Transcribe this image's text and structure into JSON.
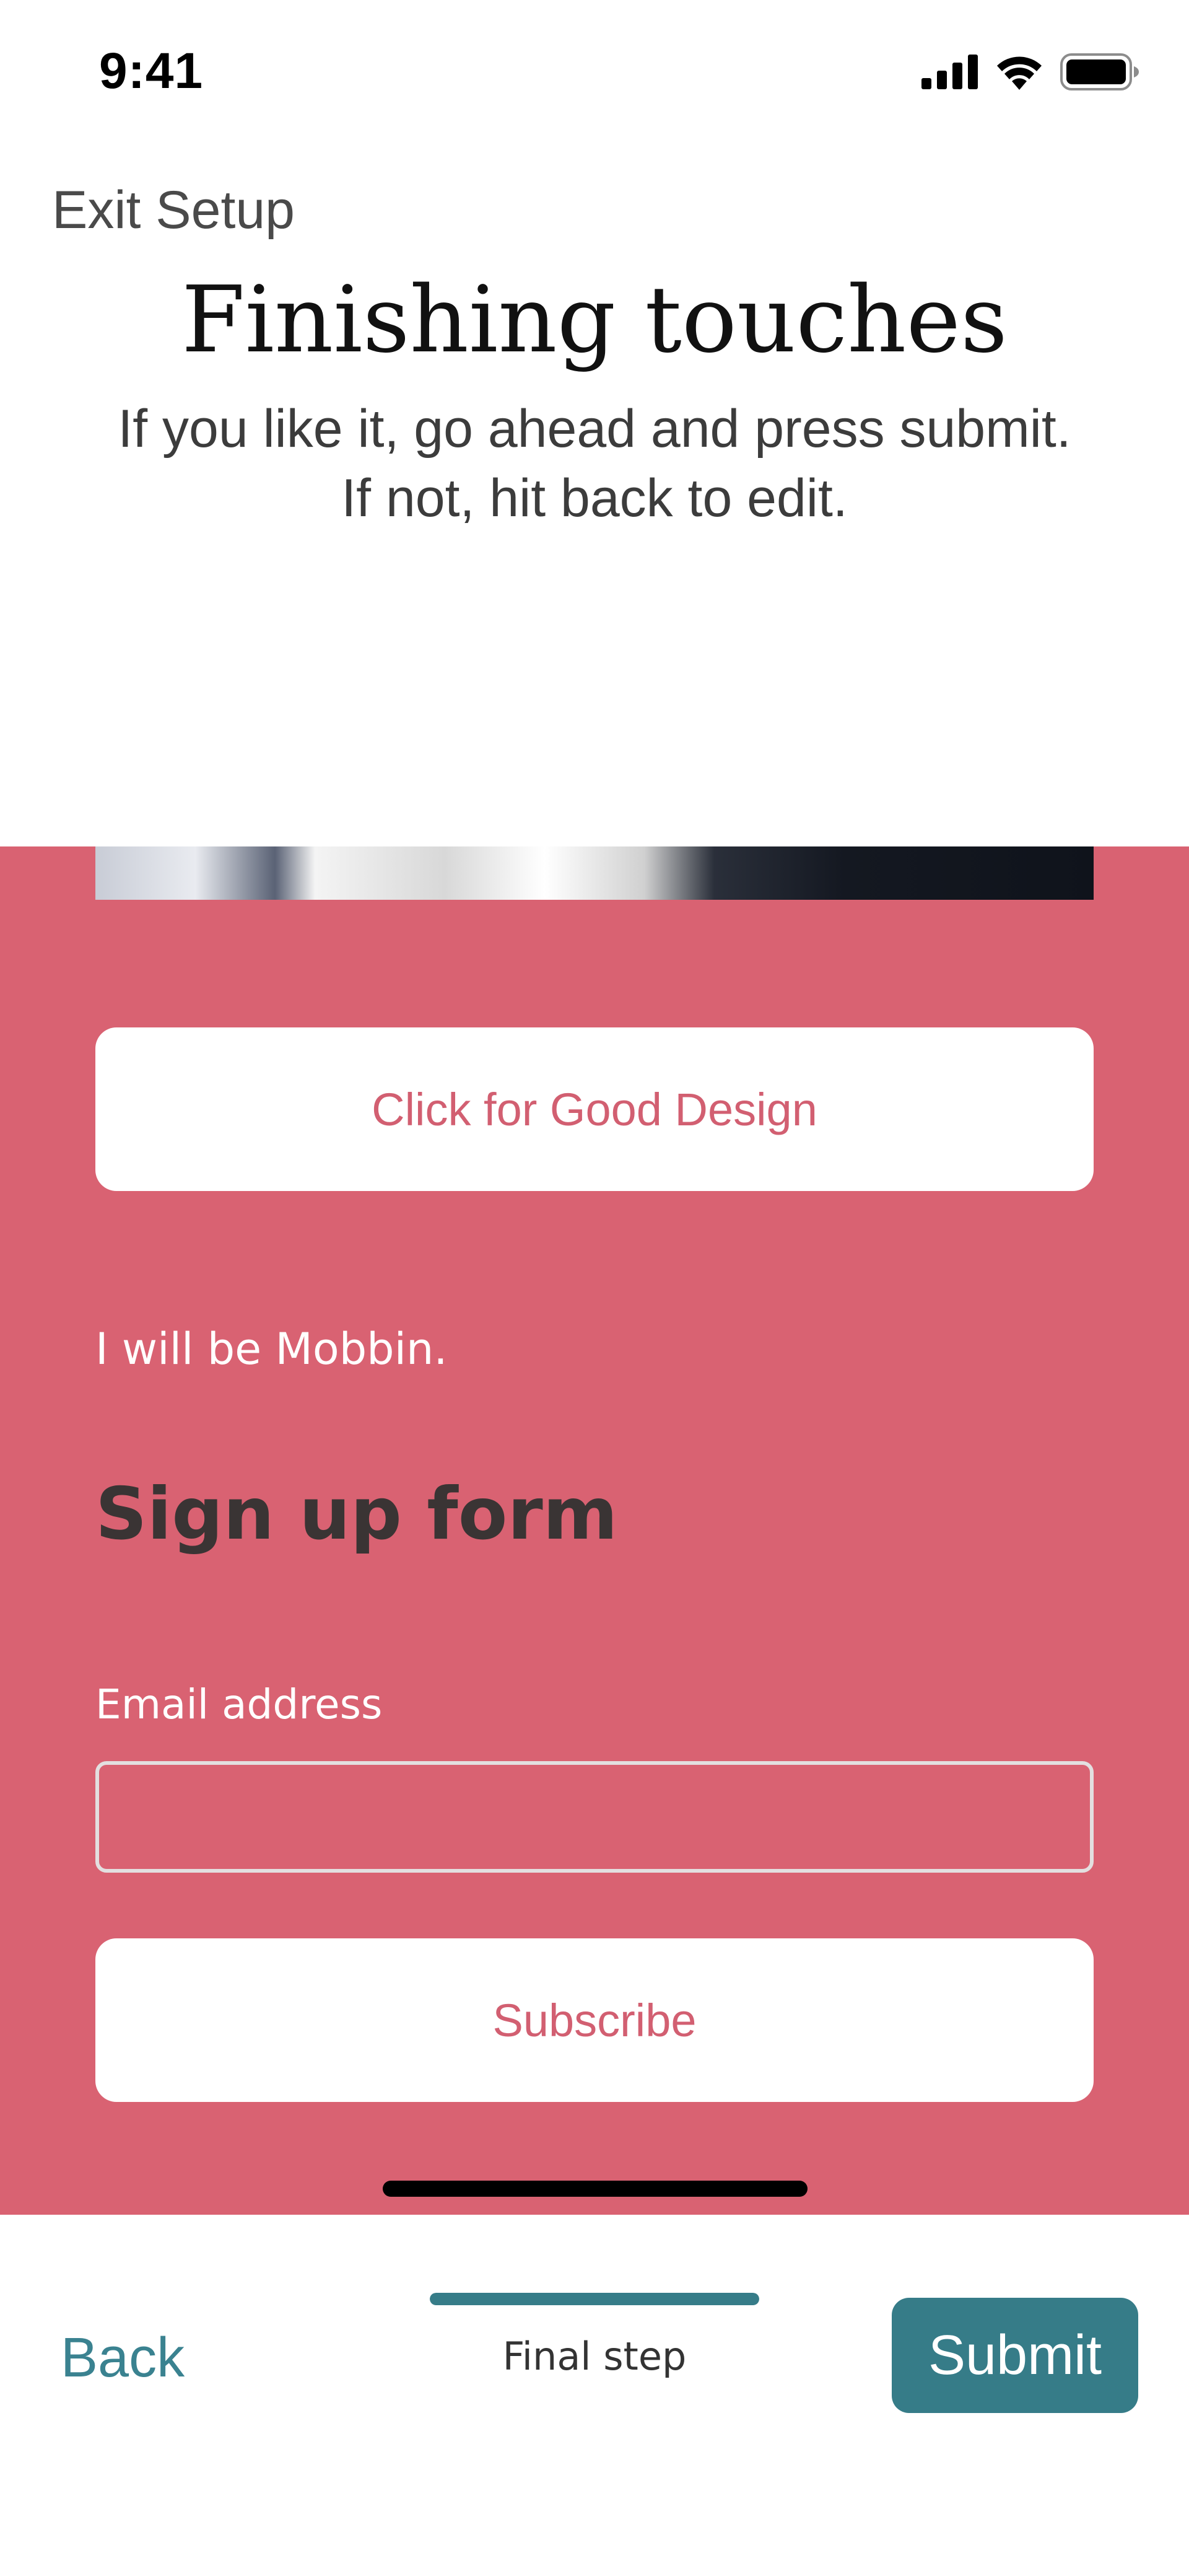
{
  "status_bar": {
    "time": "9:41",
    "icons": [
      "cellular-signal-icon",
      "wifi-icon",
      "battery-icon"
    ]
  },
  "header": {
    "exit_label": "Exit Setup",
    "title": "Finishing touches",
    "subtitle_line1": "If you like it, go ahead and press submit.",
    "subtitle_line2": "If not, hit back to edit."
  },
  "preview": {
    "background_color": "#d96272",
    "cta_label": "Click for Good Design",
    "tagline": "I will be Mobbin.",
    "form_title": "Sign up form",
    "email_label": "Email address",
    "email_value": "",
    "subscribe_label": "Subscribe"
  },
  "footer": {
    "back_label": "Back",
    "step_label": "Final step",
    "progress_fraction": 1.0,
    "submit_label": "Submit",
    "accent_color": "#367c88"
  }
}
